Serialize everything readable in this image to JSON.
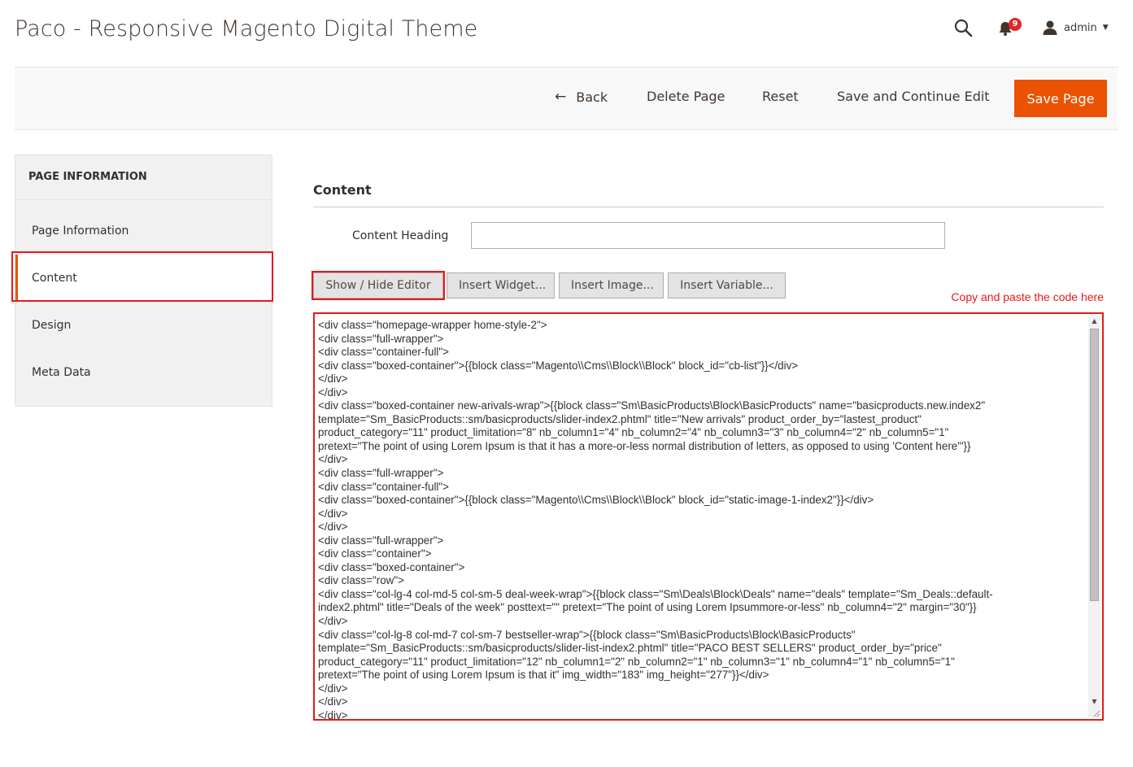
{
  "header": {
    "title": "Paco - Responsive Magento Digital Theme",
    "notification_count": "9",
    "user_name": "admin",
    "caret": "▼"
  },
  "actions": {
    "back_arrow": "←",
    "back_label": "Back",
    "delete_label": "Delete Page",
    "reset_label": "Reset",
    "save_continue_label": "Save and Continue Edit",
    "save_label": "Save Page"
  },
  "sidebar": {
    "heading": "PAGE INFORMATION",
    "items": [
      {
        "label": "Page Information"
      },
      {
        "label": "Content"
      },
      {
        "label": "Design"
      },
      {
        "label": "Meta Data"
      }
    ]
  },
  "content": {
    "section_title": "Content",
    "heading_label": "Content Heading",
    "heading_value": "",
    "buttons": {
      "toggle": "Show / Hide Editor",
      "widget": "Insert Widget...",
      "image": "Insert Image...",
      "variable": "Insert Variable..."
    },
    "annotation": "Copy and paste the code here",
    "code_lines": [
      "<div class=\"homepage-wrapper home-style-2\">",
      "<div class=\"full-wrapper\">",
      "<div class=\"container-full\">",
      "<div class=\"boxed-container\">{{block class=\"Magento\\\\Cms\\\\Block\\\\Block\" block_id=\"cb-list\"}}</div>",
      "</div>",
      "</div>",
      "<div class=\"boxed-container new-arivals-wrap\">{{block class=\"Sm\\BasicProducts\\Block\\BasicProducts\" name=\"basicproducts.new.index2\"",
      "template=\"Sm_BasicProducts::sm/basicproducts/slider-index2.phtml\" title=\"New arrivals\" product_order_by=\"lastest_product\"",
      "product_category=\"11\" product_limitation=\"8\" nb_column1=\"4\" nb_column2=\"4\" nb_column3=\"3\" nb_column4=\"2\" nb_column5=\"1\"",
      "pretext=\"The point of using Lorem Ipsum is that it has a more-or-less normal distribution of letters, as opposed to using 'Content here'\"}}",
      "</div>",
      "<div class=\"full-wrapper\">",
      "<div class=\"container-full\">",
      "<div class=\"boxed-container\">{{block class=\"Magento\\\\Cms\\\\Block\\\\Block\" block_id=\"static-image-1-index2\"}}</div>",
      "</div>",
      "</div>",
      "<div class=\"full-wrapper\">",
      "<div class=\"container\">",
      "<div class=\"boxed-container\">",
      "<div class=\"row\">",
      "<div class=\"col-lg-4 col-md-5 col-sm-5 deal-week-wrap\">{{block class=\"Sm\\Deals\\Block\\Deals\" name=\"deals\" template=\"Sm_Deals::default-",
      "index2.phtml\" title=\"Deals of the week\" posttext=\"\" pretext=\"The point of using Lorem Ipsummore-or-less\" nb_column4=\"2\" margin=\"30\"}}",
      "</div>",
      "<div class=\"col-lg-8 col-md-7 col-sm-7 bestseller-wrap\">{{block class=\"Sm\\BasicProducts\\Block\\BasicProducts\"",
      "template=\"Sm_BasicProducts::sm/basicproducts/slider-list-index2.phtml\" title=\"PACO BEST SELLERS\" product_order_by=\"price\"",
      "product_category=\"11\" product_limitation=\"12\" nb_column1=\"2\" nb_column2=\"1\" nb_column3=\"1\" nb_column4=\"1\" nb_column5=\"1\"",
      "pretext=\"The point of using Lorem Ipsum is that it\" img_width=\"183\" img_height=\"277\"}}</div>",
      "</div>",
      "</div>",
      "</div>"
    ]
  },
  "colors": {
    "accent": "#eb5202",
    "highlight": "#e81818",
    "badge": "#e22626"
  },
  "icons": {
    "search": "search-icon",
    "bell": "bell-icon",
    "user": "user-icon"
  }
}
